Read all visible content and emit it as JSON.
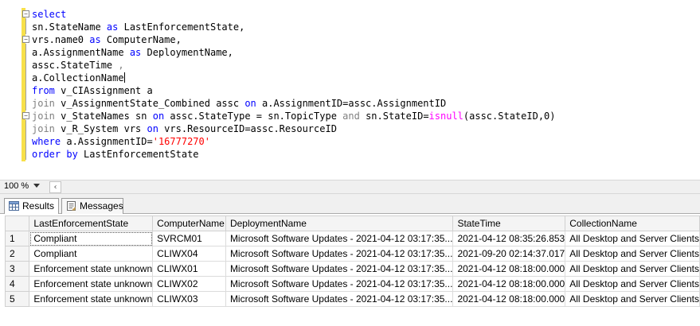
{
  "editor": {
    "lines": {
      "l1": {
        "kw1": "select"
      },
      "l2": {
        "t1": "sn.StateName ",
        "kw1": "as",
        "t2": " LastEnforcementState,"
      },
      "l3": {
        "t1": "vrs.name0 ",
        "kw1": "as",
        "t2": " ComputerName,"
      },
      "l4": {
        "t1": "a.AssignmentName ",
        "kw1": "as",
        "t2": " DeploymentName,"
      },
      "l5": {
        "t1": "assc.StateTime ",
        "gr1": ","
      },
      "l6": {
        "t1": "a.CollectionName"
      },
      "l7": {
        "kw1": "from",
        "t1": " v_CIAssignment a"
      },
      "l8": {
        "gr1": "join",
        "t1": " v_AssignmentState_Combined assc ",
        "kw1": "on",
        "t2": " a.AssignmentID=assc.AssignmentID"
      },
      "l9": {
        "gr1": "join",
        "t1": " v_StateNames sn ",
        "kw1": "on",
        "t2": " assc.StateType = sn.TopicType ",
        "gr2": "and",
        "t3": " sn.StateID=",
        "fn1": "isnull",
        "t4": "(assc.StateID,0)"
      },
      "l10": {
        "gr1": "join",
        "t1": " v_R_System vrs ",
        "kw1": "on",
        "t2": " vrs.ResourceID=assc.ResourceID"
      },
      "l11": {
        "kw1": "where",
        "t1": " a.AssignmentID=",
        "str1": "'16777270'"
      },
      "l12": {
        "kw1": "order by",
        "t1": " LastEnforcementState"
      }
    }
  },
  "zoom": {
    "level": "100 %"
  },
  "tabs": {
    "results": "Results",
    "messages": "Messages"
  },
  "grid": {
    "columns": [
      "LastEnforcementState",
      "ComputerName",
      "DeploymentName",
      "StateTime",
      "CollectionName"
    ],
    "rows": [
      {
        "num": "1",
        "state": "Compliant",
        "computer": "SVRCM01",
        "deployment": "Microsoft Software Updates - 2021-04-12 03:17:35...",
        "time": "2021-04-12 08:35:26.853",
        "collection": "All Desktop and Server Clients"
      },
      {
        "num": "2",
        "state": "Compliant",
        "computer": "CLIWX04",
        "deployment": "Microsoft Software Updates - 2021-04-12 03:17:35...",
        "time": "2021-09-20 02:14:37.017",
        "collection": "All Desktop and Server Clients"
      },
      {
        "num": "3",
        "state": "Enforcement state unknown",
        "computer": "CLIWX01",
        "deployment": "Microsoft Software Updates - 2021-04-12 03:17:35...",
        "time": "2021-04-12 08:18:00.000",
        "collection": "All Desktop and Server Clients"
      },
      {
        "num": "4",
        "state": "Enforcement state unknown",
        "computer": "CLIWX02",
        "deployment": "Microsoft Software Updates - 2021-04-12 03:17:35...",
        "time": "2021-04-12 08:18:00.000",
        "collection": "All Desktop and Server Clients"
      },
      {
        "num": "5",
        "state": "Enforcement state unknown",
        "computer": "CLIWX03",
        "deployment": "Microsoft Software Updates - 2021-04-12 03:17:35...",
        "time": "2021-04-12 08:18:00.000",
        "collection": "All Desktop and Server Clients"
      }
    ]
  },
  "colors": {
    "keyword": "#0000ff",
    "gray_keyword": "#808080",
    "function": "#ff00ff",
    "string": "#ff0000",
    "change_bar": "#f7e04a"
  }
}
